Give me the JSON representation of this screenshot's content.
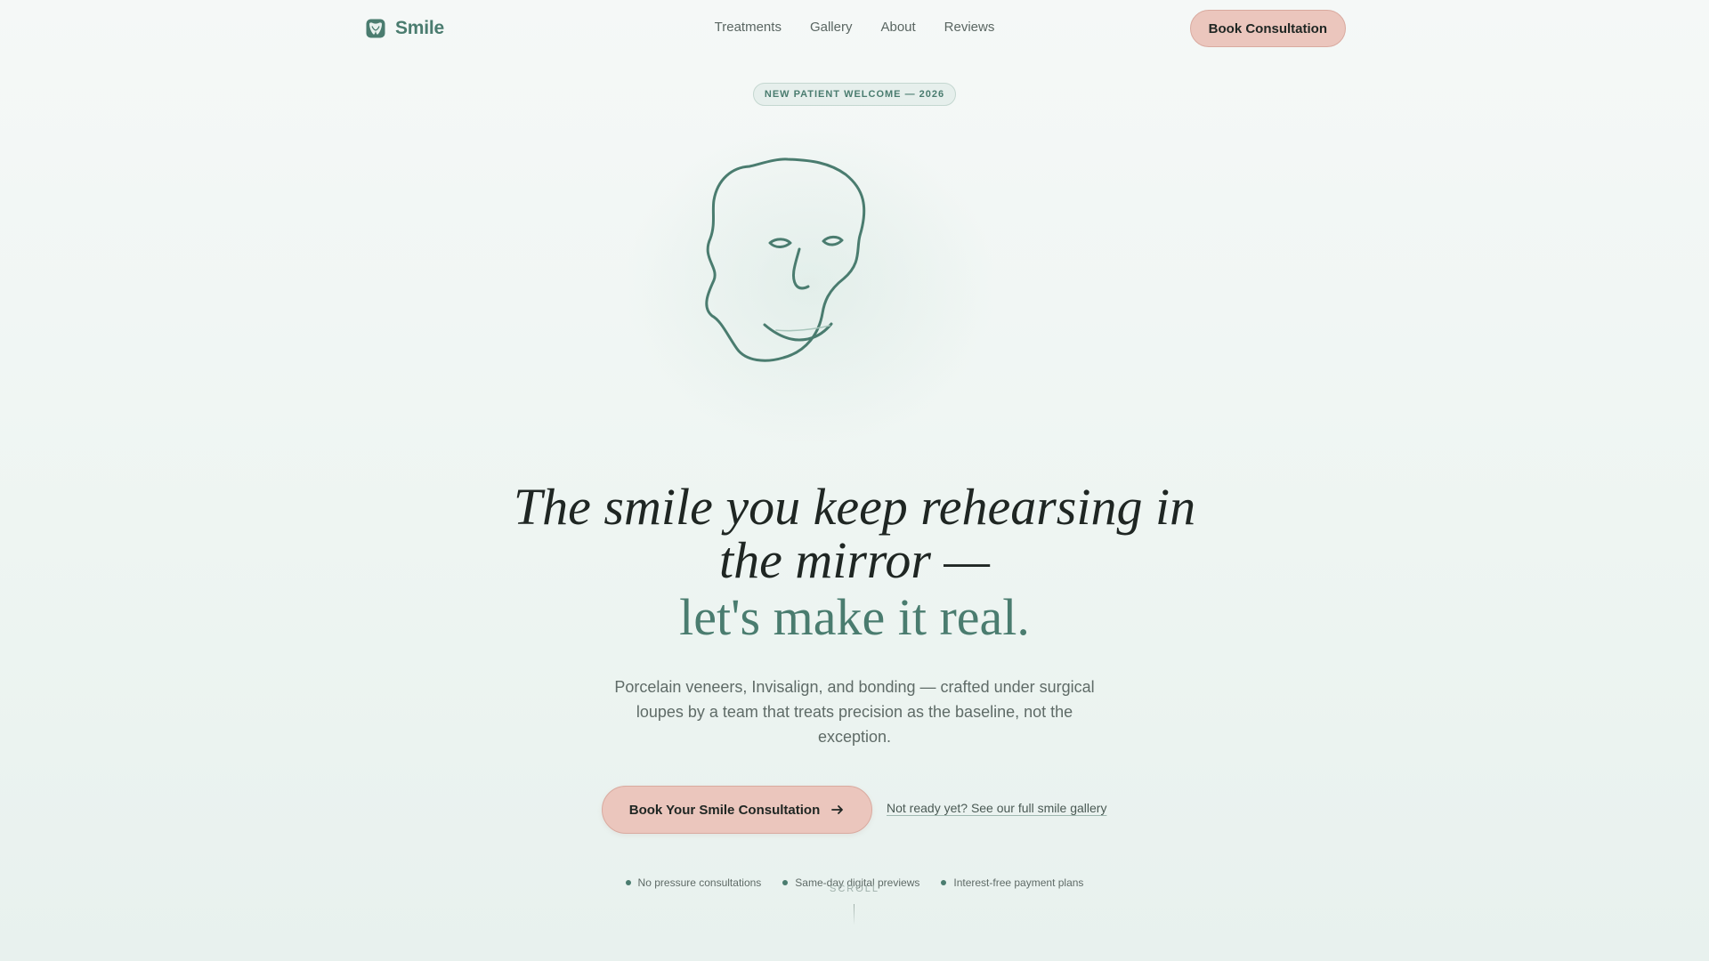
{
  "brand": {
    "name": "Smile",
    "icon": "tooth-shield-icon"
  },
  "nav": {
    "links": [
      {
        "label": "Treatments"
      },
      {
        "label": "Gallery"
      },
      {
        "label": "About"
      },
      {
        "label": "Reviews"
      }
    ],
    "cta_label": "Book Consultation"
  },
  "hero": {
    "badge": "NEW PATIENT WELCOME — 2026",
    "illustration": "face-line-drawing",
    "headline_line1": "The smile you keep rehearsing in the mirror —",
    "headline_line2": "let's make it real.",
    "subcopy": "Porcelain veneers, Invisalign, and bonding — crafted under surgical loupes by a team that treats precision as the baseline, not the exception.",
    "primary_cta": "Book Your Smile Consultation",
    "primary_cta_icon": "arrow-right-icon",
    "secondary_link": "Not ready yet? See our full smile gallery"
  },
  "features": [
    {
      "label": "No pressure consultations"
    },
    {
      "label": "Same-day digital previews"
    },
    {
      "label": "Interest-free payment plans"
    }
  ],
  "scroll": {
    "label": "SCROLL"
  },
  "colors": {
    "accent": "#4a7c6f",
    "cta_bg": "#ebc6bd",
    "cta_border": "#d9aa9f",
    "text_dark": "#1f2623",
    "text_muted": "#5f6b67",
    "background": "#f2f7f5"
  }
}
